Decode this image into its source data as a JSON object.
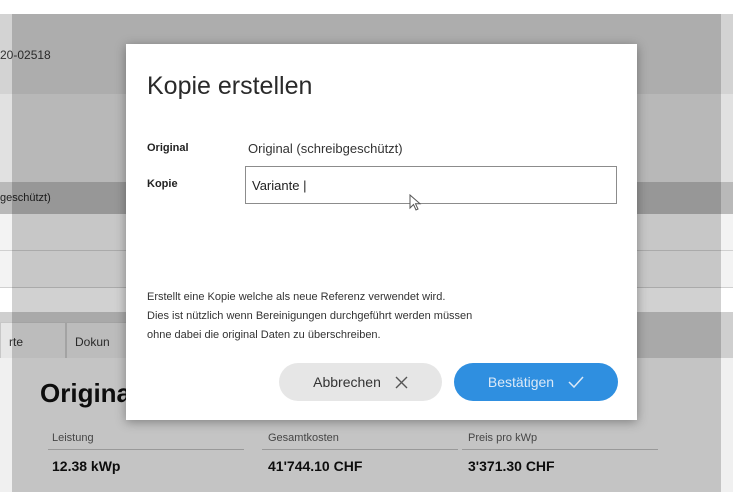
{
  "background": {
    "record_id": "20-02518",
    "table_header_fragment": "geschützt)",
    "tabs": [
      "rte",
      "Dokun"
    ],
    "section_title": "Origina",
    "kpis": [
      {
        "label": "Leistung",
        "value": "12.38 kWp"
      },
      {
        "label": "Gesamtkosten",
        "value": "41'744.10 CHF"
      },
      {
        "label": "Preis pro kWp",
        "value": "3'371.30 CHF"
      }
    ]
  },
  "dialog": {
    "title": "Kopie erstellen",
    "original_label": "Original",
    "original_value": "Original (schreibgeschützt)",
    "copy_label": "Kopie",
    "copy_value": "Variante |",
    "description": [
      "Erstellt eine Kopie welche als neue Referenz verwendet wird.",
      "Dies ist nützlich wenn Bereinigungen durchgeführt werden müssen",
      "ohne dabei die original Daten zu überschreiben."
    ],
    "cancel_label": "Abbrechen",
    "confirm_label": "Bestätigen",
    "colors": {
      "confirm": "#2f8fe0",
      "cancel": "#e6e6e6"
    }
  }
}
